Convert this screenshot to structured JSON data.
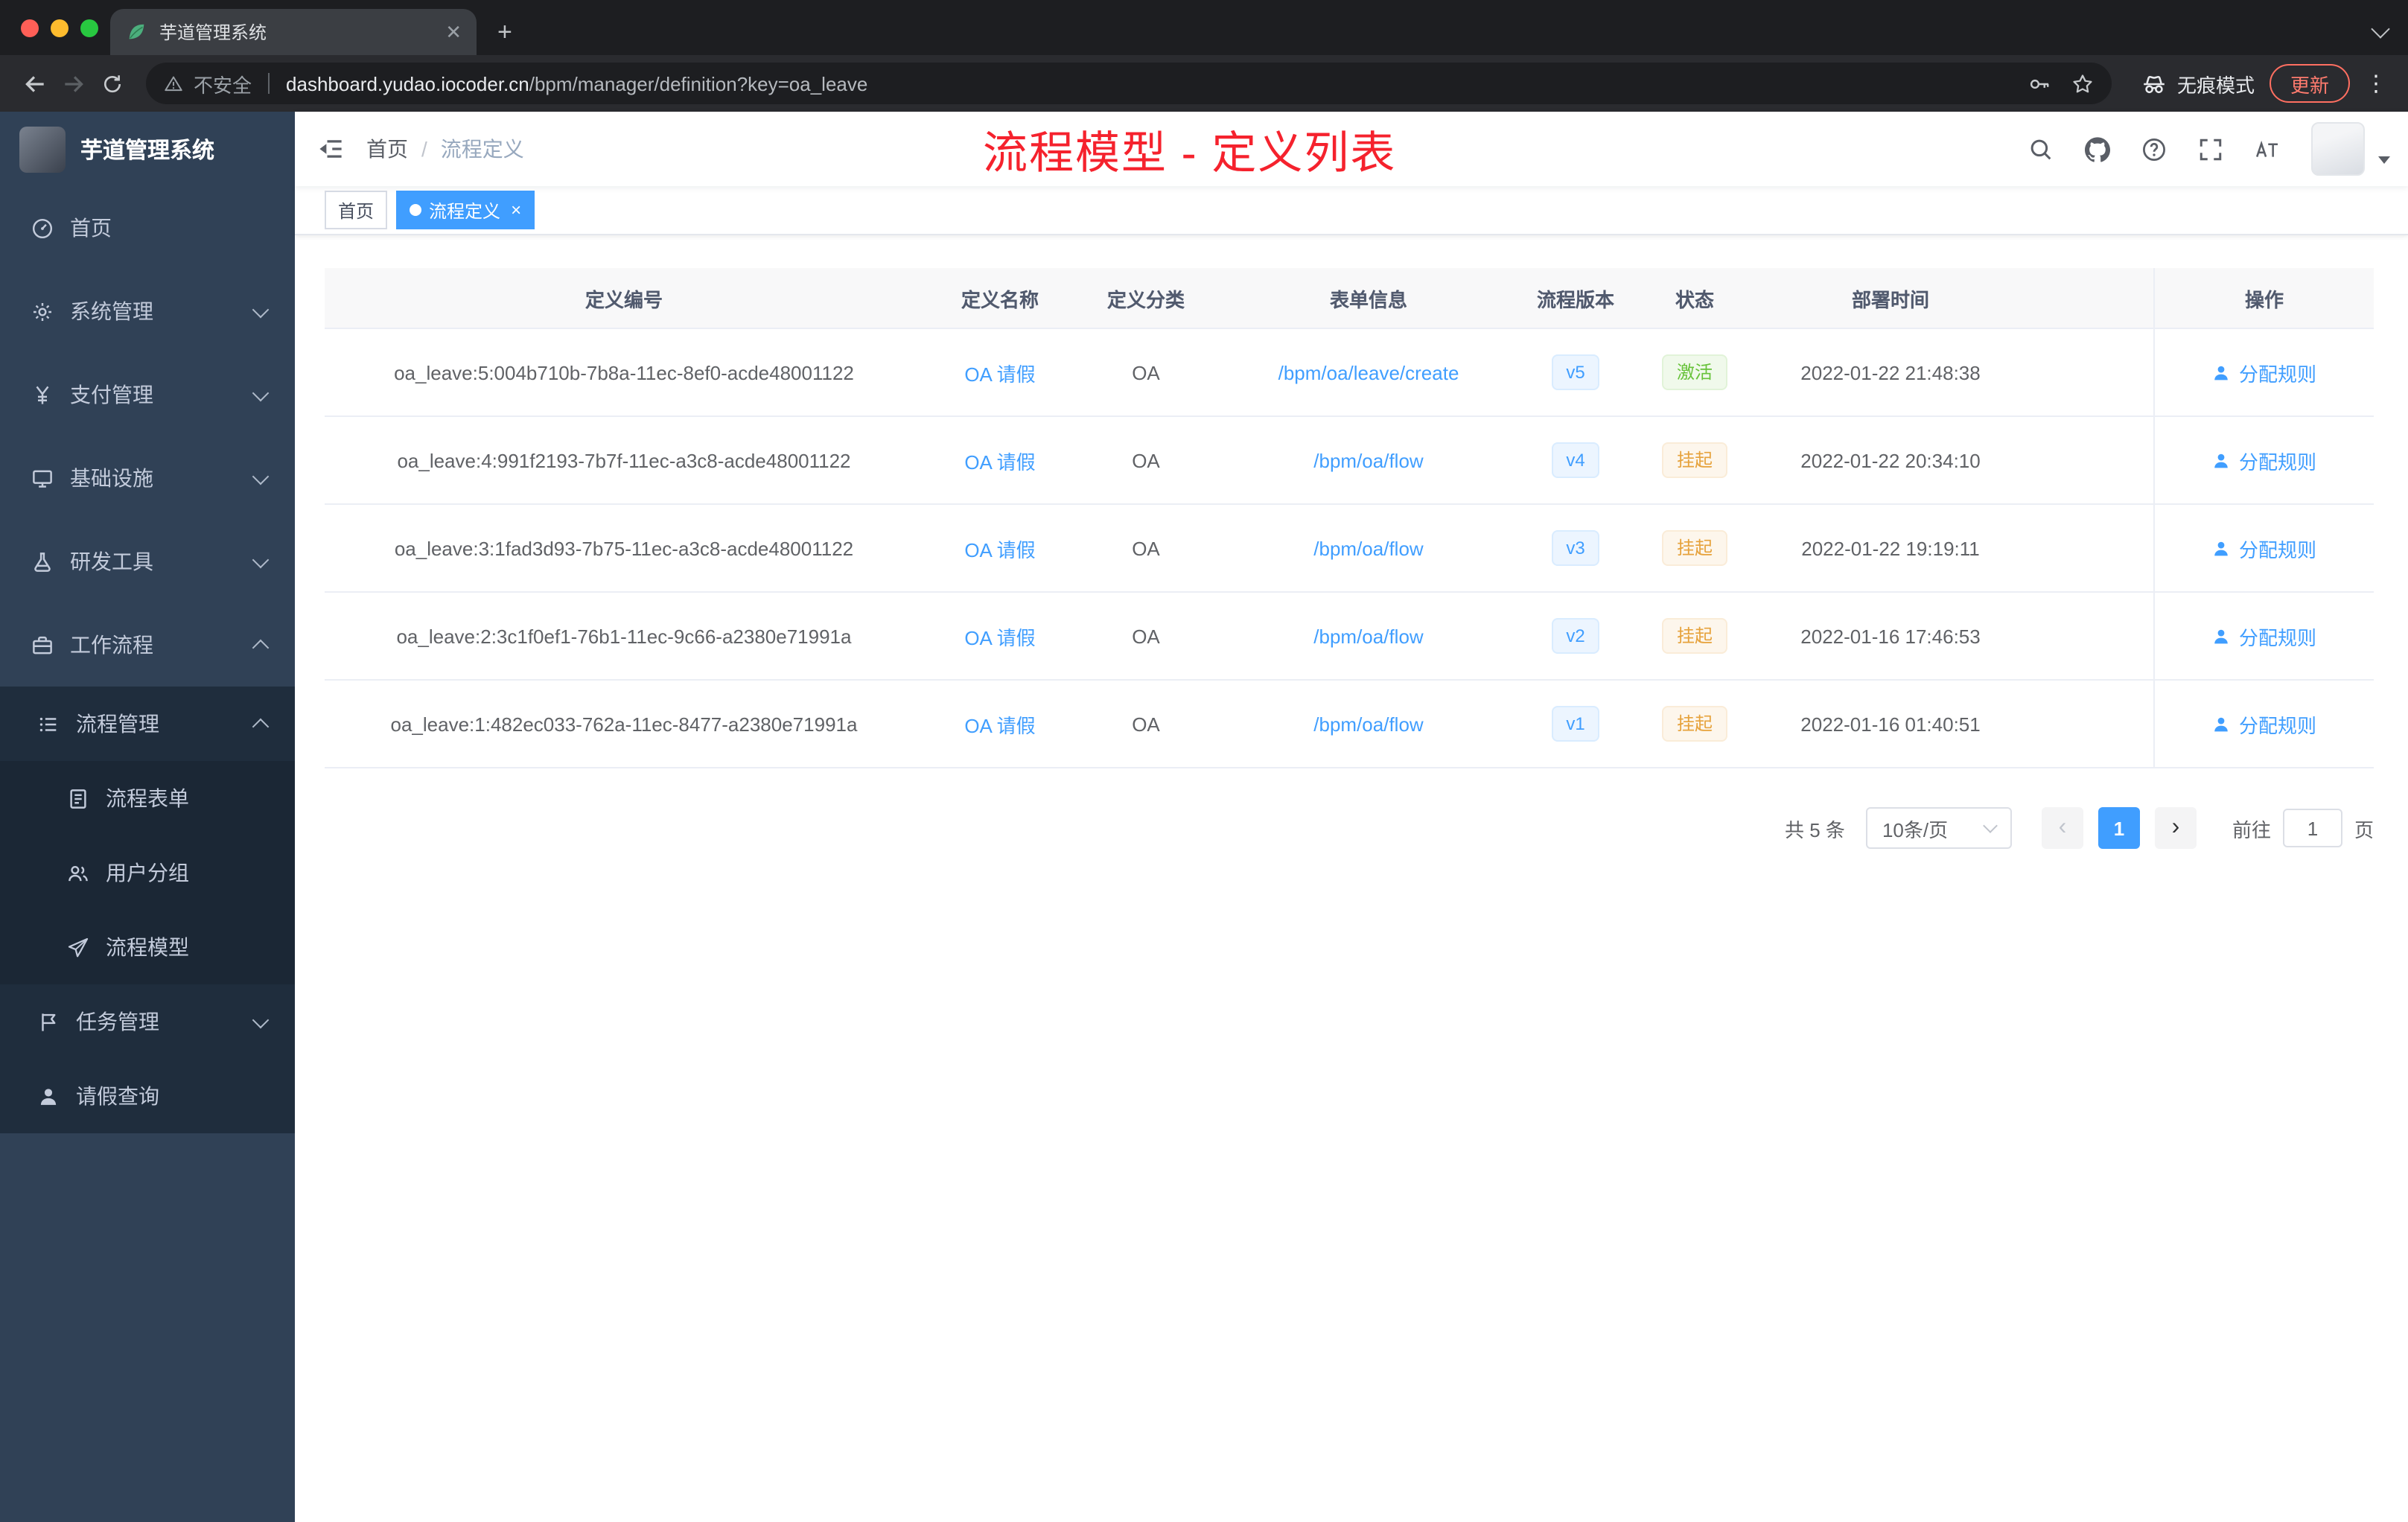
{
  "browser": {
    "tab_title": "芋道管理系统",
    "new_tab_label": "+",
    "security_label": "不安全",
    "url_domain": "dashboard.yudao.iocoder.cn",
    "url_path": "/bpm/manager/definition?key=oa_leave",
    "incognito_label": "无痕模式",
    "update_label": "更新",
    "kebab_label": "⋮"
  },
  "sidebar": {
    "app_title": "芋道管理系统",
    "menu": [
      {
        "key": "home",
        "label": "首页",
        "icon": "gauge",
        "level": 1,
        "arrow": "",
        "sub": false
      },
      {
        "key": "system",
        "label": "系统管理",
        "icon": "gear",
        "level": 1,
        "arrow": "down",
        "sub": false
      },
      {
        "key": "payment",
        "label": "支付管理",
        "icon": "yen",
        "level": 1,
        "arrow": "down",
        "sub": false
      },
      {
        "key": "infrastructure",
        "label": "基础设施",
        "icon": "monitor",
        "level": 1,
        "arrow": "down",
        "sub": false
      },
      {
        "key": "devtools",
        "label": "研发工具",
        "icon": "flask",
        "level": 1,
        "arrow": "down",
        "sub": false
      },
      {
        "key": "workflow",
        "label": "工作流程",
        "icon": "briefcase",
        "level": 1,
        "arrow": "up",
        "sub": false
      },
      {
        "key": "process-manage",
        "label": "流程管理",
        "icon": "list",
        "level": 2,
        "arrow": "up",
        "sub": true
      },
      {
        "key": "process-form",
        "label": "流程表单",
        "icon": "doc",
        "level": 3,
        "arrow": "",
        "sub": true
      },
      {
        "key": "user-group",
        "label": "用户分组",
        "icon": "users",
        "level": 3,
        "arrow": "",
        "sub": true
      },
      {
        "key": "process-model",
        "label": "流程模型",
        "icon": "plane",
        "level": 3,
        "arrow": "",
        "sub": true
      },
      {
        "key": "task-manage",
        "label": "任务管理",
        "icon": "task",
        "level": 2,
        "arrow": "down",
        "sub": true
      },
      {
        "key": "leave-query",
        "label": "请假查询",
        "icon": "person",
        "level": 2,
        "arrow": "",
        "sub": true
      }
    ]
  },
  "navbar": {
    "breadcrumb": [
      "首页",
      "流程定义"
    ],
    "breadcrumb_separator": "/",
    "annotation": "流程模型 - 定义列表",
    "icons": [
      "search-icon",
      "github-icon",
      "help-icon",
      "fullscreen-icon",
      "font-size-icon",
      "avatar",
      "chevron-down-icon"
    ]
  },
  "tags": [
    {
      "label": "首页",
      "active": false
    },
    {
      "label": "流程定义",
      "active": true,
      "close": "×"
    }
  ],
  "table": {
    "headers": [
      "定义编号",
      "定义名称",
      "定义分类",
      "表单信息",
      "流程版本",
      "状态",
      "部署时间",
      "操作"
    ],
    "rows": [
      {
        "id": "oa_leave:5:004b710b-7b8a-11ec-8ef0-acde48001122",
        "name": "OA 请假",
        "category": "OA",
        "form": "/bpm/oa/leave/create",
        "version": "v5",
        "status": "激活",
        "status_type": "success",
        "deploy_time": "2022-01-22 21:48:38",
        "action": "分配规则"
      },
      {
        "id": "oa_leave:4:991f2193-7b7f-11ec-a3c8-acde48001122",
        "name": "OA 请假",
        "category": "OA",
        "form": "/bpm/oa/flow",
        "version": "v4",
        "status": "挂起",
        "status_type": "warning",
        "deploy_time": "2022-01-22 20:34:10",
        "action": "分配规则"
      },
      {
        "id": "oa_leave:3:1fad3d93-7b75-11ec-a3c8-acde48001122",
        "name": "OA 请假",
        "category": "OA",
        "form": "/bpm/oa/flow",
        "version": "v3",
        "status": "挂起",
        "status_type": "warning",
        "deploy_time": "2022-01-22 19:19:11",
        "action": "分配规则"
      },
      {
        "id": "oa_leave:2:3c1f0ef1-76b1-11ec-9c66-a2380e71991a",
        "name": "OA 请假",
        "category": "OA",
        "form": "/bpm/oa/flow",
        "version": "v2",
        "status": "挂起",
        "status_type": "warning",
        "deploy_time": "2022-01-16 17:46:53",
        "action": "分配规则"
      },
      {
        "id": "oa_leave:1:482ec033-762a-11ec-8477-a2380e71991a",
        "name": "OA 请假",
        "category": "OA",
        "form": "/bpm/oa/flow",
        "version": "v1",
        "status": "挂起",
        "status_type": "warning",
        "deploy_time": "2022-01-16 01:40:51",
        "action": "分配规则"
      }
    ]
  },
  "pagination": {
    "total": "共 5 条",
    "page_size": "10条/页",
    "prev": "‹",
    "current_page": "1",
    "next": "›",
    "goto_prefix": "前往",
    "goto_value": "1",
    "goto_suffix": "页"
  },
  "colors": {
    "accent": "#409EFF",
    "success": "#67C23A",
    "warning": "#E6A23C",
    "annotation_red": "#F5222D",
    "sidebar_bg": "#304156",
    "sidebar_sub_bg": "#1F2D3D"
  }
}
